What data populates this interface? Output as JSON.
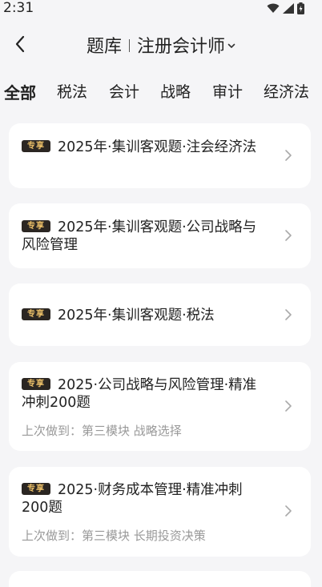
{
  "status": {
    "time": "2:31"
  },
  "header": {
    "left_title": "题库",
    "right_title": "注册会计师"
  },
  "tabs": [
    "全部",
    "税法",
    "会计",
    "战略",
    "审计",
    "经济法"
  ],
  "badge_label": "专享",
  "cards": [
    {
      "title": "2025年·集训客观题·注会经济法",
      "progress": ""
    },
    {
      "title": "2025年·集训客观题·公司战略与风险管理",
      "progress": ""
    },
    {
      "title": "2025年·集训客观题·税法",
      "progress": ""
    },
    {
      "title": "2025·公司战略与风险管理·精准冲刺200题",
      "progress": "上次做到：第三模块 战略选择"
    },
    {
      "title": "2025·财务成本管理·精准冲刺200题",
      "progress": "上次做到：第三模块 长期投资决策"
    }
  ],
  "colors": {
    "badge_bg": "#2b2622",
    "badge_text": "#f0c36a",
    "page_bg": "#f5f5f7"
  }
}
